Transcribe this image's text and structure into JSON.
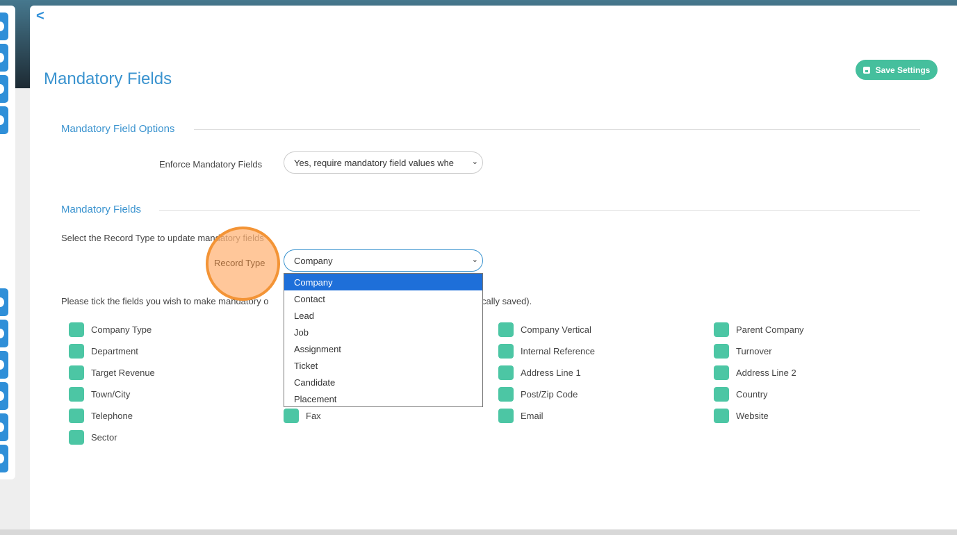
{
  "header": {
    "back_label": "<",
    "title": "Mandatory Fields",
    "save_label": "Save Settings"
  },
  "options_section": {
    "title": "Mandatory Field Options",
    "enforce_label": "Enforce Mandatory Fields",
    "enforce_value": "Yes, require mandatory field values whe"
  },
  "fields_section": {
    "title": "Mandatory Fields",
    "instruction": "Select the Record Type to update mandatory fields",
    "record_type_label": "Record Type",
    "record_type_value": "Company",
    "record_type_options": [
      "Company",
      "Contact",
      "Lead",
      "Job",
      "Assignment",
      "Ticket",
      "Candidate",
      "Placement"
    ],
    "tick_text_start": "Please tick the fields you wish to make mandatory o",
    "tick_text_end": "cally saved).",
    "columns": [
      [
        "Company Type",
        "Department",
        "Target Revenue",
        "Town/City",
        "Telephone",
        "Sector"
      ],
      [
        "",
        "",
        "",
        "",
        "Fax"
      ],
      [
        "Company Vertical",
        "Internal Reference",
        "Address Line 1",
        "Post/Zip Code",
        "Email"
      ],
      [
        "Parent Company",
        "Turnover",
        "Address Line 2",
        "Country",
        "Website"
      ]
    ]
  },
  "colors": {
    "accent": "#3a93cf",
    "save": "#45bf9d",
    "checkbox": "#4cc6a4",
    "highlight": "#1e6fd9"
  }
}
